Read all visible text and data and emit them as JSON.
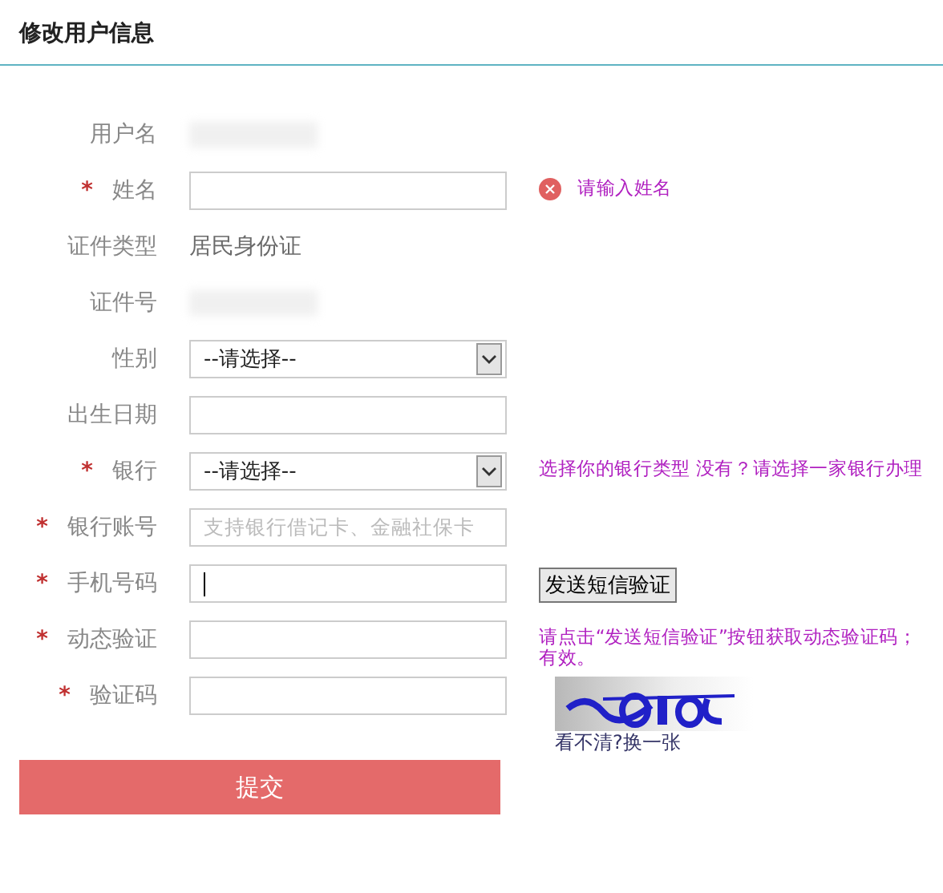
{
  "title": "修改用户信息",
  "fields": [
    {
      "label": "用户名",
      "kind": "redacted"
    },
    {
      "label": "姓名",
      "mark": "*",
      "kind": "input",
      "hint": {
        "kind": "error",
        "lines": [
          "请输入姓名"
        ]
      }
    },
    {
      "label": "证件类型",
      "kind": "static",
      "value": "居民身份证"
    },
    {
      "label": "证件号",
      "kind": "redacted"
    },
    {
      "label": "性别",
      "kind": "select",
      "value": "--请选择--"
    },
    {
      "label": "出生日期",
      "kind": "input"
    },
    {
      "label": "银行",
      "mark": "*",
      "kind": "select",
      "value": "--请选择--",
      "hint": {
        "kind": "info",
        "lines": [
          "选择你的银行类型 没有？请选择一家银行办理"
        ]
      }
    },
    {
      "label": "银行账号",
      "mark": "*",
      "kind": "input",
      "placeholder": "支持银行借记卡、金融社保卡"
    },
    {
      "label": "手机号码",
      "mark": "*",
      "kind": "input",
      "focused": true,
      "button": "发送短信验证"
    },
    {
      "label": "动态验证",
      "mark": "*",
      "kind": "input",
      "hint": {
        "kind": "info",
        "lines": [
          "请点击“发送短信验证”按钮获取动态验证码；",
          "有效。"
        ]
      }
    },
    {
      "label": "验证码",
      "mark": "*",
      "kind": "input",
      "captcha": {
        "kind": "picture",
        "link": "看不清?换一张"
      }
    }
  ],
  "submit": "提交"
}
